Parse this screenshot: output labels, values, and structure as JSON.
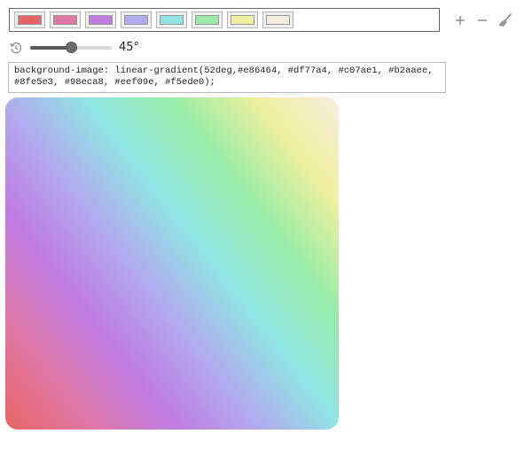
{
  "swatches": [
    {
      "color": "#e86464"
    },
    {
      "color": "#df77a4"
    },
    {
      "color": "#c07ae1"
    },
    {
      "color": "#b2aaee"
    },
    {
      "color": "#8fe5e3"
    },
    {
      "color": "#98eca8"
    },
    {
      "color": "#eef09e"
    },
    {
      "color": "#f5ede0"
    }
  ],
  "toolbar": {
    "add_icon": "plus-icon",
    "remove_icon": "minus-icon",
    "clear_icon": "broom-icon"
  },
  "angle": {
    "reset_icon": "history-icon",
    "value": 45,
    "min": 0,
    "max": 90,
    "display": "45°"
  },
  "css_output": {
    "text": "background-image: linear-gradient(52deg,#e86464, #df77a4, #c07ae1, #b2aaee, #8fe5e3, #98eca8, #eef09e, #f5ede0);"
  },
  "preview": {
    "gradient_angle": "52deg"
  }
}
